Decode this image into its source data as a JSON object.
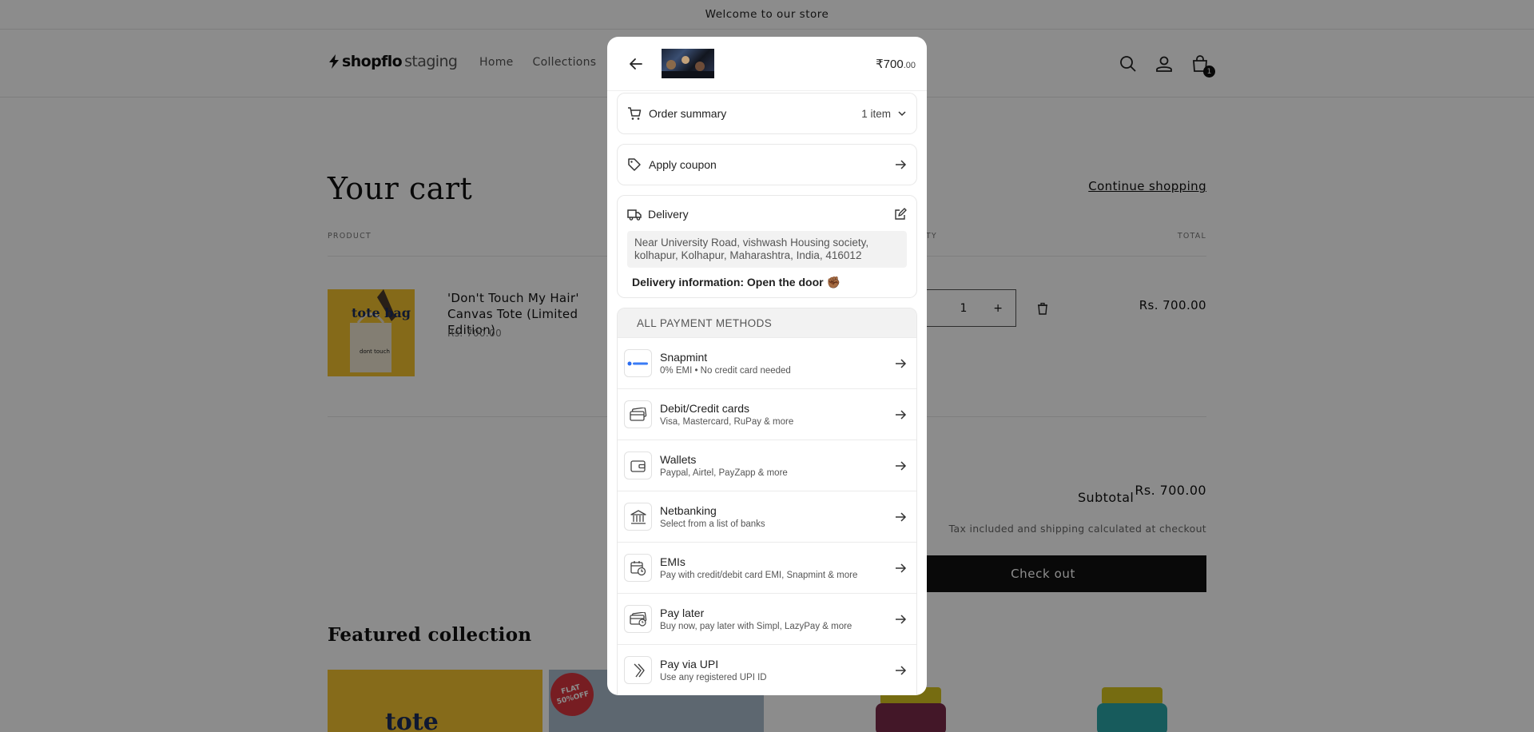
{
  "store": {
    "announcement": "Welcome to our store",
    "logo_brand": "shopflo",
    "logo_suffix": "staging",
    "nav": [
      "Home",
      "Collections"
    ],
    "cart_count": "1",
    "cart_title": "Your cart",
    "continue_shopping": "Continue shopping",
    "columns": {
      "product": "PRODUCT",
      "quantity": "QUANTITY",
      "total": "TOTAL"
    },
    "item": {
      "name": "'Don't Touch My Hair' Canvas Tote (Limited Edition)",
      "price": "Rs. 700.00",
      "quantity": "1",
      "total": "Rs. 700.00",
      "image_text": "tote bag"
    },
    "subtotal_label": "Subtotal",
    "subtotal_value": "Rs. 700.00",
    "tax_note": "Tax included and shipping calculated at checkout",
    "checkout_label": "Check out",
    "featured_title": "Featured collection",
    "featured_badge": "FLAT 50%OFF",
    "featured_text": "tote"
  },
  "modal": {
    "price_main": "₹700",
    "price_decimals": ".00",
    "order_summary": {
      "label": "Order summary",
      "count": "1 item"
    },
    "coupon": {
      "label": "Apply coupon"
    },
    "delivery": {
      "label": "Delivery",
      "address_line1": "Near University Road, vishwash Housing society,",
      "address_line2": "kolhapur, Kolhapur, Maharashtra, India, 416012",
      "info": "Delivery information: Open the door ✊🏾"
    },
    "payment_title": "ALL PAYMENT METHODS",
    "payment_methods": [
      {
        "name": "Snapmint",
        "desc": "0% EMI • No credit card needed",
        "icon": "snapmint-logo-icon"
      },
      {
        "name": "Debit/Credit cards",
        "desc": "Visa, Mastercard, RuPay & more",
        "icon": "credit-card-icon"
      },
      {
        "name": "Wallets",
        "desc": "Paypal, Airtel, PayZapp & more",
        "icon": "wallet-icon"
      },
      {
        "name": "Netbanking",
        "desc": "Select from a list of banks",
        "icon": "bank-icon"
      },
      {
        "name": "EMIs",
        "desc": "Pay with credit/debit card EMI, Snapmint & more",
        "icon": "calendar-clock-icon"
      },
      {
        "name": "Pay later",
        "desc": "Buy now, pay later with Simpl, LazyPay & more",
        "icon": "pay-later-icon"
      },
      {
        "name": "Pay via UPI",
        "desc": "Use any registered UPI ID",
        "icon": "upi-icon"
      }
    ]
  },
  "colors": {
    "overlay": "#000000",
    "checkout_button": "#121212",
    "logo_mark": "#111111"
  }
}
